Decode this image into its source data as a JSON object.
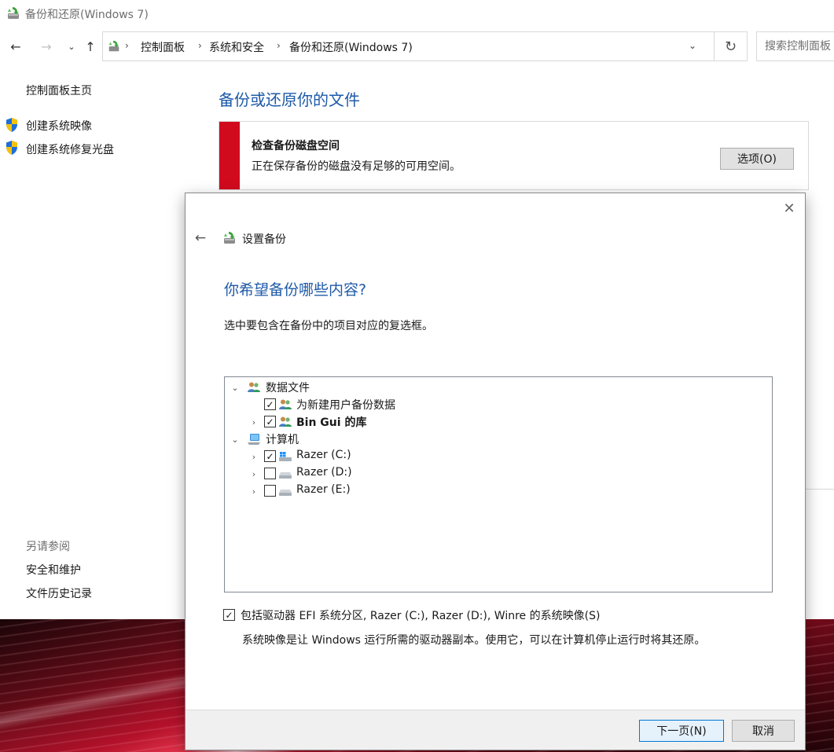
{
  "window": {
    "title": "备份和还原(Windows 7)"
  },
  "navbar": {
    "breadcrumbs": [
      "控制面板",
      "系统和安全",
      "备份和还原(Windows 7)"
    ],
    "search_placeholder": "搜索控制面板"
  },
  "sidebar": {
    "home_link": "控制面板主页",
    "links": [
      "创建系统映像",
      "创建系统修复光盘"
    ],
    "see_also_heading": "另请参阅",
    "see_also_links": [
      "安全和维护",
      "文件历史记录"
    ]
  },
  "main": {
    "heading": "备份或还原你的文件",
    "alert": {
      "title": "检查备份磁盘空间",
      "text": "正在保存备份的磁盘没有足够的可用空间。",
      "button": "选项(O)",
      "color": "#d10a1e"
    }
  },
  "dialog": {
    "title": "设置备份",
    "heading": "你希望备份哪些内容?",
    "instruction": "选中要包含在备份中的项目对应的复选框。",
    "tree": {
      "data_files": {
        "label": "数据文件",
        "children": [
          {
            "label": "为新建用户备份数据",
            "checked": true
          },
          {
            "label": "Bin Gui 的库",
            "checked": true
          }
        ]
      },
      "computer": {
        "label": "计算机",
        "children": [
          {
            "label": "Razer (C:)",
            "checked": true
          },
          {
            "label": "Razer (D:)",
            "checked": false
          },
          {
            "label": "Razer (E:)",
            "checked": false
          }
        ]
      }
    },
    "system_image": {
      "label": "包括驱动器 EFI 系统分区, Razer (C:), Razer (D:), Winre 的系统映像(S)",
      "checked": true,
      "description": "系统映像是让 Windows 运行所需的驱动器副本。使用它，可以在计算机停止运行时将其还原。"
    },
    "next_button": "下一页(N)",
    "cancel_button": "取消"
  }
}
